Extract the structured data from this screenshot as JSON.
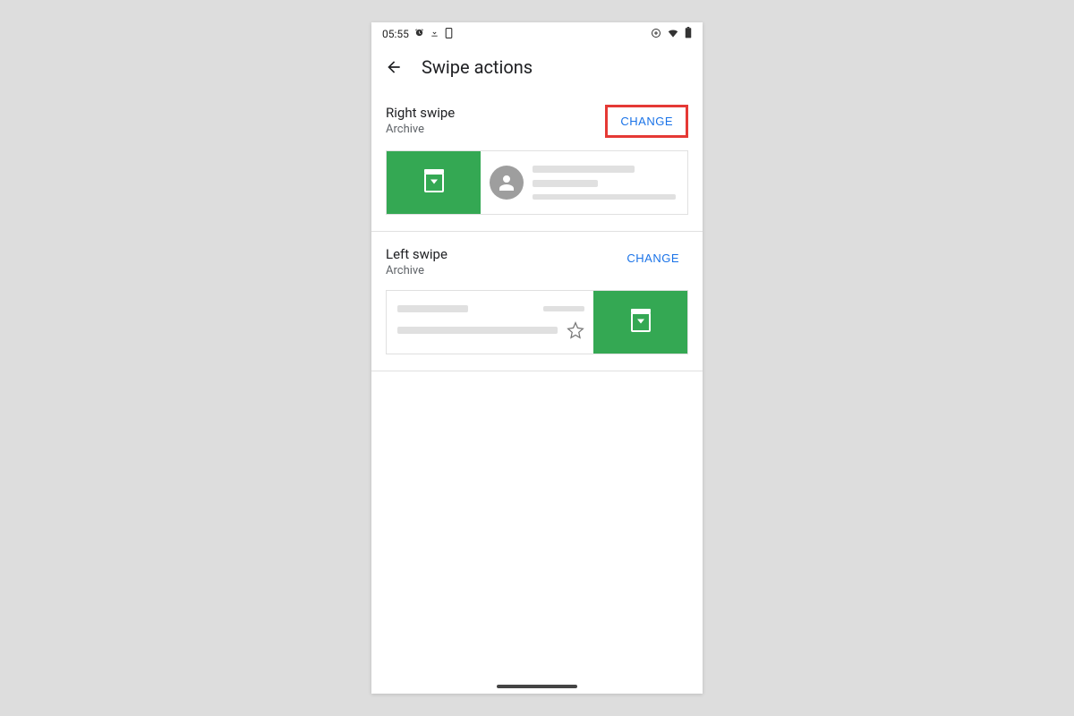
{
  "status": {
    "time": "05:55",
    "icons_left": [
      "alarm",
      "download",
      "phone"
    ],
    "icons_right": [
      "data-saver",
      "wifi",
      "battery"
    ]
  },
  "header": {
    "title": "Swipe actions"
  },
  "sections": {
    "right": {
      "title": "Right swipe",
      "subtitle": "Archive",
      "change_label": "CHANGE",
      "action_color": "#34a853",
      "highlighted": true
    },
    "left": {
      "title": "Left swipe",
      "subtitle": "Archive",
      "change_label": "CHANGE",
      "action_color": "#34a853",
      "highlighted": false
    }
  }
}
